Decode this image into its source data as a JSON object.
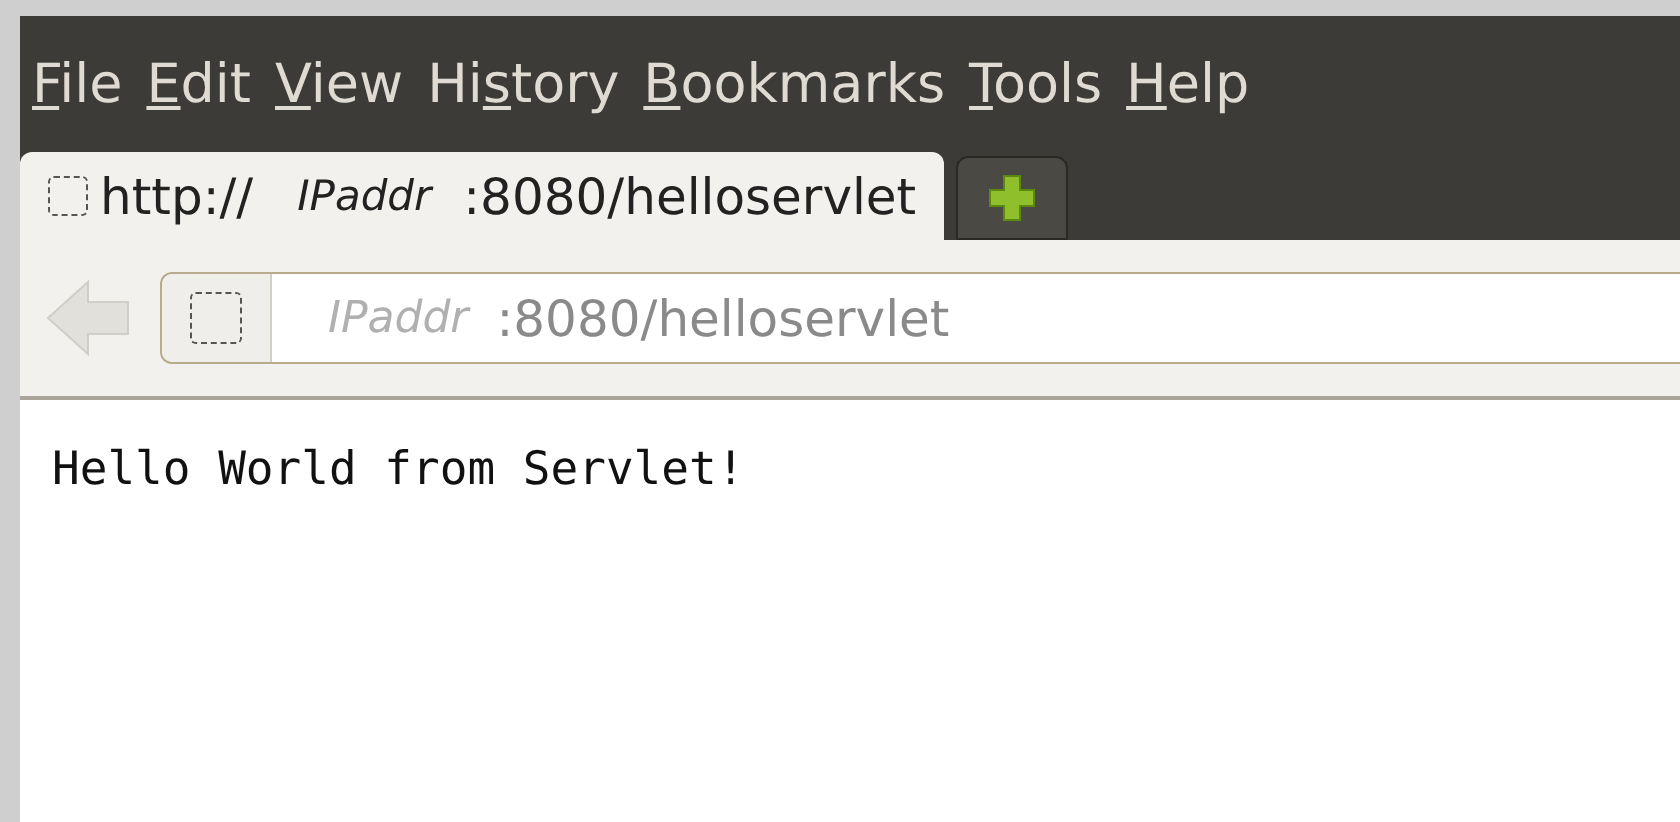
{
  "menu": [
    {
      "key": "F",
      "after": "ile"
    },
    {
      "key": "E",
      "after": "dit"
    },
    {
      "key": "V",
      "after": "iew"
    },
    {
      "before": "Hi",
      "key": "s",
      "after": "tory"
    },
    {
      "key": "B",
      "after": "ookmarks"
    },
    {
      "key": "T",
      "after": "ools"
    },
    {
      "key": "H",
      "after": "elp"
    }
  ],
  "tabs": [
    {
      "parts": [
        "http://",
        "IPaddr",
        ":8080/helloservlet"
      ],
      "selected": true
    }
  ],
  "nav": {
    "back_disabled": true,
    "address_parts": [
      "IPaddr",
      ":8080/helloservlet"
    ]
  },
  "content": {
    "text": "Hello World from Servlet!"
  }
}
